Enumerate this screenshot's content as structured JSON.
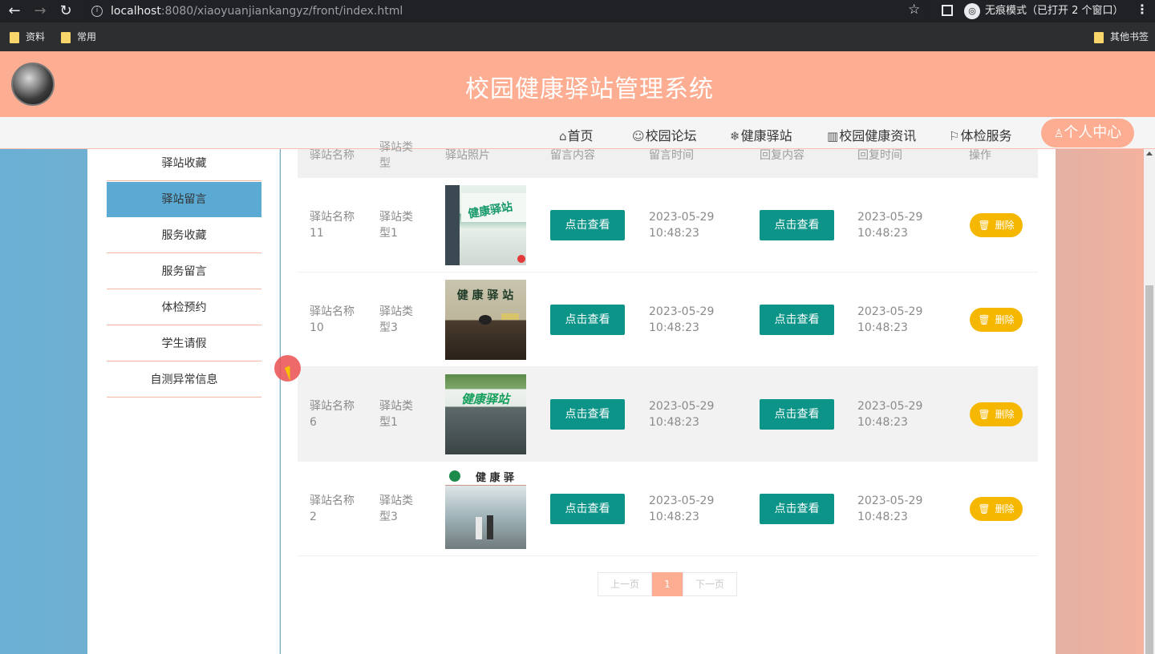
{
  "browser": {
    "url_host": "localhost",
    "url_rest": ":8080/xiaoyuanjiankangyz/front/index.html",
    "incognito_label": "无痕模式（已打开 2 个窗口）",
    "bookmarks": [
      {
        "label": "资料"
      },
      {
        "label": "常用"
      }
    ],
    "other_bookmarks": "其他书签"
  },
  "header": {
    "title": "校园健康驿站管理系统"
  },
  "nav": {
    "items": [
      {
        "icon": "home-icon",
        "label": "首页"
      },
      {
        "icon": "forum-icon",
        "label": "校园论坛"
      },
      {
        "icon": "snowflake-icon",
        "label": "健康驿站"
      },
      {
        "icon": "news-icon",
        "label": "校园健康资讯"
      },
      {
        "icon": "flag-icon",
        "label": "体检服务"
      }
    ],
    "user_center": "个人中心"
  },
  "sidebar": {
    "items": [
      {
        "label": "驿站收藏"
      },
      {
        "label": "驿站留言"
      },
      {
        "label": "服务收藏"
      },
      {
        "label": "服务留言"
      },
      {
        "label": "体检预约"
      },
      {
        "label": "学生请假"
      },
      {
        "label": "自测异常信息"
      }
    ],
    "active_index": 1
  },
  "table": {
    "headers": [
      "驿站名称",
      "驿站类型",
      "驿站照片",
      "留言内容",
      "留言时间",
      "回复内容",
      "回复时间",
      "操作"
    ],
    "view_label": "点击查看",
    "delete_label": "删除",
    "rows": [
      {
        "name": [
          "驿站名称",
          "11"
        ],
        "type": [
          "驿站类",
          "型1"
        ],
        "photo": "健康驿站",
        "time": [
          "2023-05-29",
          "10:48:23"
        ],
        "reply_time": [
          "2023-05-29",
          "10:48:23"
        ]
      },
      {
        "name": [
          "驿站名称",
          "10"
        ],
        "type": [
          "驿站类",
          "型3"
        ],
        "photo": "健 康 驿 站",
        "time": [
          "2023-05-29",
          "10:48:23"
        ],
        "reply_time": [
          "2023-05-29",
          "10:48:23"
        ]
      },
      {
        "name": [
          "驿站名称",
          "6"
        ],
        "type": [
          "驿站类",
          "型1"
        ],
        "photo": "健康驿站",
        "time": [
          "2023-05-29",
          "10:48:23"
        ],
        "reply_time": [
          "2023-05-29",
          "10:48:23"
        ]
      },
      {
        "name": [
          "驿站名称",
          "2"
        ],
        "type": [
          "驿站类",
          "型3"
        ],
        "photo": "健 康 驿",
        "time": [
          "2023-05-29",
          "10:48:23"
        ],
        "reply_time": [
          "2023-05-29",
          "10:48:23"
        ]
      }
    ]
  },
  "pagination": {
    "prev": "上一页",
    "current": "1",
    "next": "下一页"
  }
}
